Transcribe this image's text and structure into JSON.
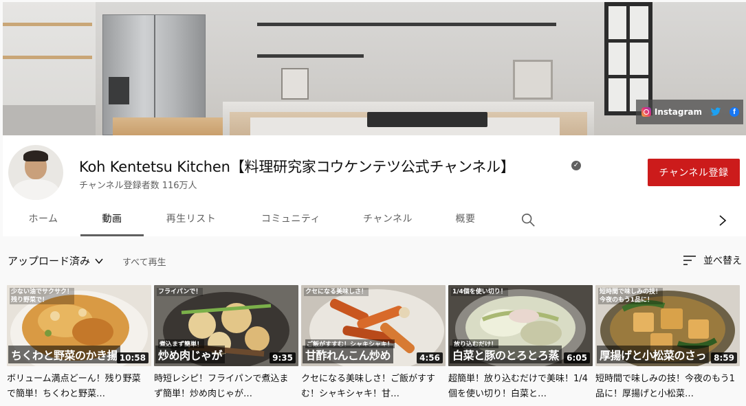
{
  "banner": {
    "links": {
      "instagram_label": "Instagram",
      "icons": [
        "instagram-icon",
        "twitter-icon",
        "facebook-icon"
      ]
    }
  },
  "channel": {
    "title": "Koh Kentetsu Kitchen【料理研究家コウケンテツ公式チャンネル】",
    "subscribers": "チャンネル登録者数 116万人",
    "subscribe_label": "チャンネル登録",
    "verified_glyph": "✓"
  },
  "tabs": [
    {
      "label": "ホーム"
    },
    {
      "label": "動画",
      "active": true
    },
    {
      "label": "再生リスト"
    },
    {
      "label": "コミュニティ"
    },
    {
      "label": "チャンネル"
    },
    {
      "label": "概要"
    }
  ],
  "toolbar": {
    "uploaded_label": "アップロード済み",
    "play_all_label": "すべて再生",
    "sort_label": "並べ替え"
  },
  "videos": [
    {
      "top_caption": "少ない油でサクサク！\n残り野菜で！",
      "small_caption": "",
      "big_caption": "ちくわと野菜のかき揚",
      "duration": "10:58",
      "title": "ボリューム満点どーん！残り野菜で簡単！ちくわと野菜…"
    },
    {
      "top_caption": "フライパンで！",
      "small_caption": "煮込まず簡単！",
      "big_caption": "炒め肉じゃが",
      "duration": "9:35",
      "title": "時短レシピ！フライパンで煮込まず簡単！炒め肉じゃが…"
    },
    {
      "top_caption": "クセになる美味しさ！",
      "small_caption": "ご飯がすすむ！シャキシャキ！",
      "big_caption": "甘酢れんこん炒め",
      "duration": "4:56",
      "title": "クセになる美味しさ！ご飯がすすむ！シャキシャキ！甘…"
    },
    {
      "top_caption": "1/4個を使い切り！",
      "small_caption": "放り込むだけ！",
      "big_caption": "白菜と豚のとろとろ蒸",
      "duration": "6:05",
      "title": "超簡単！放り込むだけで美味！1/4個を使い切り！白菜と…"
    },
    {
      "top_caption": "短時間で味しみの技！\n今夜のもう1品に！",
      "small_caption": "",
      "big_caption": "厚揚げと小松菜のさっ",
      "duration": "8:59",
      "title": "短時間で味しみの技！今夜のもう1品に！厚揚げと小松菜…"
    }
  ],
  "colors": {
    "subscribe": "#cc1b1b",
    "background": "#f9f9f9",
    "text_secondary": "#606060"
  }
}
